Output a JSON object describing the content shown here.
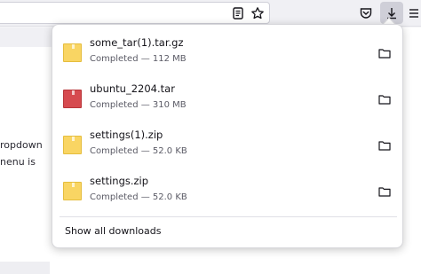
{
  "toolbar": {
    "icons": [
      "reader-view-icon",
      "bookmark-star-icon",
      "pocket-icon",
      "download-arrow-icon",
      "hamburger-menu-icon"
    ]
  },
  "page": {
    "line1": "ropdown",
    "line2": "nenu is"
  },
  "downloads": {
    "items": [
      {
        "name": "some_tar(1).tar.gz",
        "status": "Completed — 112 MB",
        "icon": "archive-file-icon",
        "color": "#f9d563"
      },
      {
        "name": "ubuntu_2204.tar",
        "status": "Completed — 310 MB",
        "icon": "package-file-icon",
        "color": "#d64a4f"
      },
      {
        "name": "settings(1).zip",
        "status": "Completed — 52.0 KB",
        "icon": "archive-file-icon",
        "color": "#f9d563"
      },
      {
        "name": "settings.zip",
        "status": "Completed — 52.0 KB",
        "icon": "archive-file-icon",
        "color": "#f9d563"
      }
    ],
    "show_all_label": "Show all downloads"
  }
}
